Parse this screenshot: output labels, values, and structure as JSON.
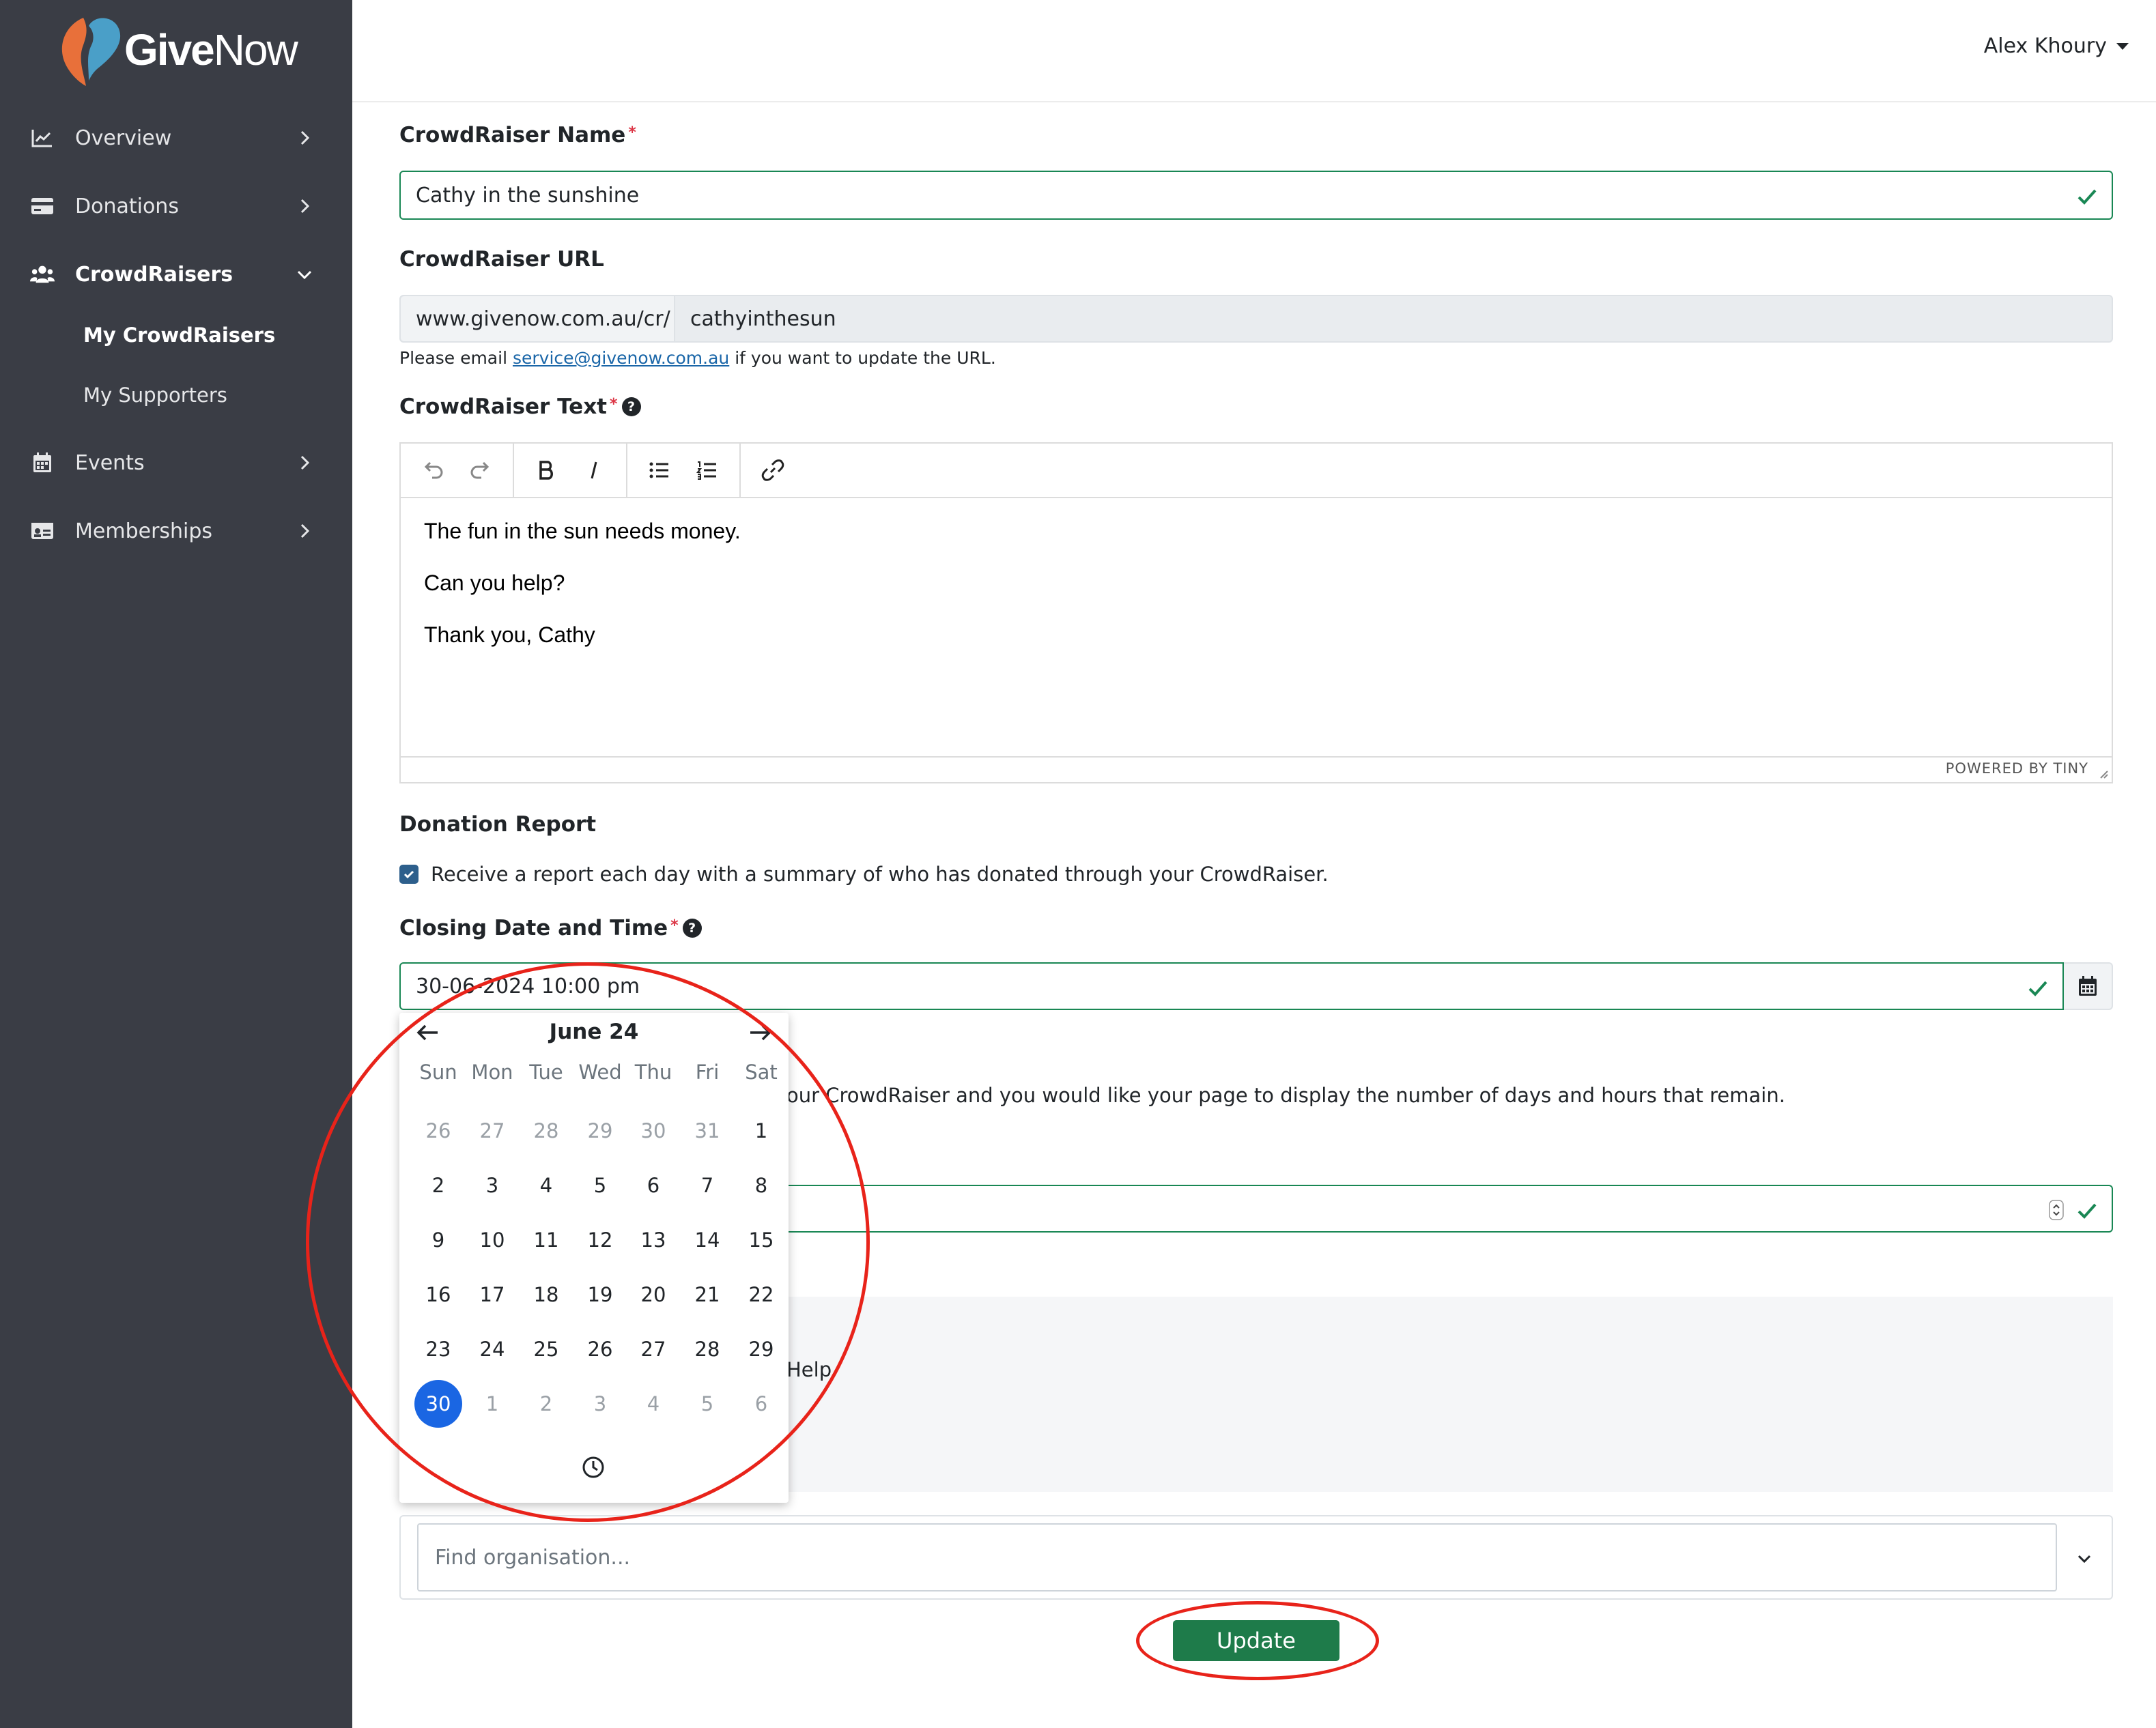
{
  "brand": {
    "name_bold": "Give",
    "name_light": "Now"
  },
  "user": {
    "name": "Alex Khoury"
  },
  "sidebar": {
    "items": [
      {
        "label": "Overview",
        "icon": "chart-line-icon"
      },
      {
        "label": "Donations",
        "icon": "credit-card-icon"
      },
      {
        "label": "CrowdRaisers",
        "icon": "users-icon"
      },
      {
        "label": "Events",
        "icon": "calendar-icon"
      },
      {
        "label": "Memberships",
        "icon": "id-card-icon"
      }
    ],
    "sub_items": [
      {
        "label": "My CrowdRaisers"
      },
      {
        "label": "My Supporters"
      }
    ]
  },
  "form": {
    "name_label": "CrowdRaiser Name",
    "name_value": "Cathy in the sunshine",
    "url_label": "CrowdRaiser URL",
    "url_prefix": "www.givenow.com.au/cr/",
    "url_value": "cathyinthesun",
    "url_note_before": "Please email",
    "url_note_link": "service@givenow.com.au",
    "url_note_after": "if you want to update the URL.",
    "text_label": "CrowdRaiser Text",
    "editor_paragraphs": [
      "The fun in the sun needs money.",
      "Can you help?",
      "Thank you, Cathy"
    ],
    "powered_by": "POWERED BY TINY",
    "report_label": "Donation Report",
    "report_checkbox": "Receive a report each day with a summary of who has donated through your CrowdRaiser.",
    "closing_label": "Closing Date and Time",
    "closing_value": "30-06-2024 10:00 pm",
    "hint_fragment": "our CrowdRaiser and you would like your page to display the number of days and hours that remain.",
    "help_fragment": "Help",
    "org_placeholder": "Find organisation...",
    "update_label": "Update"
  },
  "datepicker": {
    "title": "June 24",
    "weekdays": [
      "Sun",
      "Mon",
      "Tue",
      "Wed",
      "Thu",
      "Fri",
      "Sat"
    ],
    "weeks": [
      [
        "26",
        "27",
        "28",
        "29",
        "30",
        "31",
        "1"
      ],
      [
        "2",
        "3",
        "4",
        "5",
        "6",
        "7",
        "8"
      ],
      [
        "9",
        "10",
        "11",
        "12",
        "13",
        "14",
        "15"
      ],
      [
        "16",
        "17",
        "18",
        "19",
        "20",
        "21",
        "22"
      ],
      [
        "23",
        "24",
        "25",
        "26",
        "27",
        "28",
        "29"
      ],
      [
        "30",
        "1",
        "2",
        "3",
        "4",
        "5",
        "6"
      ]
    ],
    "selected": "30"
  },
  "colors": {
    "sidebar": "#3a3d45",
    "valid_green": "#198754",
    "button_green": "#1e7b4a",
    "selected_blue": "#1a66e3",
    "annotation_red": "#e8231a"
  }
}
